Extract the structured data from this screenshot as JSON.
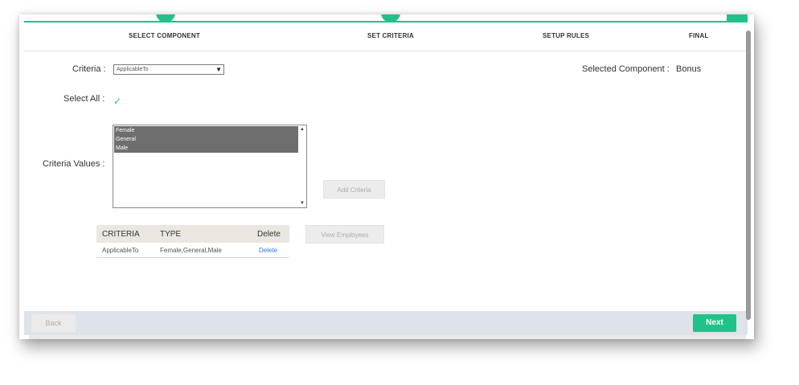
{
  "wizard": {
    "steps": [
      {
        "label": "SELECT COMPONENT"
      },
      {
        "label": "SET CRITERIA"
      },
      {
        "label": "SETUP RULES"
      },
      {
        "label": "FINAL"
      }
    ],
    "accent_color": "#1fc38a"
  },
  "form": {
    "criteria_label": "Criteria :",
    "criteria_value": "ApplicableTo",
    "select_all_label": "Select All :",
    "select_all_checked": true,
    "criteria_values_label": "Criteria Values :",
    "criteria_options": [
      "Female",
      "General",
      "Male"
    ],
    "add_criteria_label": "Add Criteria",
    "view_employees_label": "View Employees",
    "selected_component_label": "Selected Component :",
    "selected_component_value": "Bonus"
  },
  "criteria_table": {
    "headers": [
      "CRITERIA",
      "TYPE",
      "Delete"
    ],
    "rows": [
      {
        "criteria": "ApplicableTo",
        "type": "Female,General,Male",
        "action": "Delete"
      }
    ]
  },
  "footer": {
    "back_label": "Back",
    "next_label": "Next"
  }
}
